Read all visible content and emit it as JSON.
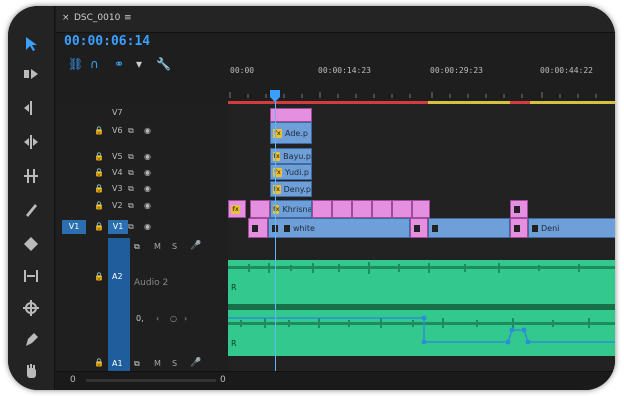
{
  "sequence": {
    "name": "DSC_0010",
    "menu_glyph": "≡",
    "close_glyph": "×"
  },
  "timecode": "00:00:06:14",
  "ruler": {
    "labels": [
      "00:00",
      "00:00:14:23",
      "00:00:29:23",
      "00:00:44:22"
    ]
  },
  "video_tracks": [
    {
      "name": "V7"
    },
    {
      "name": "V6"
    },
    {
      "name": "V5"
    },
    {
      "name": "V4"
    },
    {
      "name": "V3"
    },
    {
      "name": "V2"
    },
    {
      "name": "V1",
      "source": "V1"
    }
  ],
  "audio": {
    "a2": {
      "name": "A2",
      "label": "Audio 2",
      "volume_label": "0,"
    },
    "a1": {
      "name": "A1"
    },
    "m_label": "M",
    "s_label": "S"
  },
  "clips": {
    "v6": "Ade.p",
    "v5": "Bayu.p",
    "v4": "Yudi.p",
    "v3": "Deny.p",
    "v2": "Khrisna",
    "v1": "white",
    "v1_end": "Deni"
  },
  "bottom": {
    "left_value": "0",
    "right_value": "0"
  },
  "colors": {
    "accent": "#3aa0ff",
    "clip_pink": "#e48fe0",
    "clip_blue": "#6f9fd8",
    "audio": "#33c98e"
  }
}
